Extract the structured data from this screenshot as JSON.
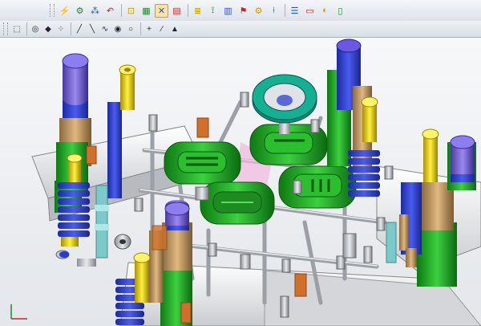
{
  "toolbar_top": {
    "buttons": [
      {
        "icon": "bolt-icon",
        "glyph": "⚡"
      },
      {
        "icon": "gear-icon",
        "glyph": "⚙"
      },
      {
        "icon": "pattern-icon",
        "glyph": "⁂"
      },
      {
        "icon": "undo-icon",
        "glyph": "↶"
      },
      {
        "icon": "sketch-icon",
        "glyph": "⊡"
      },
      {
        "icon": "grid-icon",
        "glyph": "▦"
      },
      {
        "icon": "tools-icon",
        "glyph": "✕",
        "active": true
      },
      {
        "icon": "table-icon",
        "glyph": "▤"
      },
      {
        "icon": "layers-icon",
        "glyph": "≣"
      },
      {
        "icon": "pin-icon",
        "glyph": "⟟"
      },
      {
        "icon": "bars-icon",
        "glyph": "▥"
      },
      {
        "icon": "flag-icon",
        "glyph": "⚑"
      },
      {
        "icon": "settings-icon",
        "glyph": "⚙"
      },
      {
        "icon": "ruler-icon",
        "glyph": "⟊"
      },
      {
        "icon": "list-icon",
        "glyph": "☰"
      },
      {
        "icon": "window-icon",
        "glyph": "▭"
      },
      {
        "icon": "palette-icon",
        "glyph": "◐"
      },
      {
        "icon": "document-icon",
        "glyph": "▯"
      }
    ]
  },
  "toolbar_second": {
    "buttons": [
      {
        "icon": "select-icon",
        "glyph": "⬚"
      },
      {
        "icon": "eye-icon",
        "glyph": "◎"
      },
      {
        "icon": "cube-icon",
        "glyph": "◆"
      },
      {
        "icon": "dots-icon",
        "glyph": "⁘"
      },
      {
        "icon": "line-icon",
        "glyph": "╱"
      },
      {
        "icon": "line2-icon",
        "glyph": "╲"
      },
      {
        "icon": "curve-icon",
        "glyph": "∿"
      },
      {
        "icon": "target-icon",
        "glyph": "◉"
      },
      {
        "icon": "circle-icon",
        "glyph": "○"
      },
      {
        "icon": "plus-icon",
        "glyph": "+"
      },
      {
        "icon": "slash-icon",
        "glyph": "∕"
      },
      {
        "icon": "cursor-icon",
        "glyph": "▲"
      }
    ]
  },
  "colors": {
    "mold_base": "#f2f2f2",
    "cavity_green": "#1faa22",
    "pin_gold": "#e6d000",
    "spring_blue": "#2a3bd0",
    "shaft_tan": "#c9a06a",
    "ring_teal": "#11a088"
  }
}
